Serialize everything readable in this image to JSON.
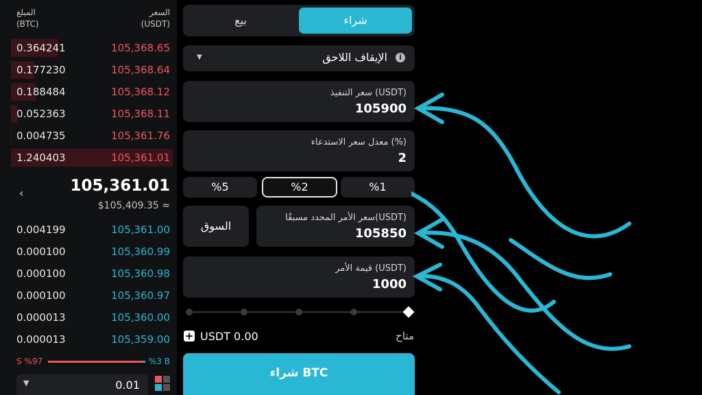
{
  "book": {
    "amount_header": "المبلغ",
    "amount_unit": "(BTC)",
    "price_header": "السعر",
    "price_unit": "(USDT)",
    "asks": [
      {
        "amount": "0.364241",
        "price": "105,368.65"
      },
      {
        "amount": "0.177230",
        "price": "105,368.64"
      },
      {
        "amount": "0.188484",
        "price": "105,368.12"
      },
      {
        "amount": "0.052363",
        "price": "105,368.11"
      },
      {
        "amount": "0.004735",
        "price": "105,361.76"
      },
      {
        "amount": "1.240403",
        "price": "105,361.01"
      }
    ],
    "last_price": "105,361.01",
    "last_price_usd": "$105,409.35 ≈",
    "bids": [
      {
        "amount": "0.004199",
        "price": "105,361.00"
      },
      {
        "amount": "0.000100",
        "price": "105,360.99"
      },
      {
        "amount": "0.000100",
        "price": "105,360.98"
      },
      {
        "amount": "0.000100",
        "price": "105,360.97"
      },
      {
        "amount": "0.000013",
        "price": "105,360.00"
      },
      {
        "amount": "0.000013",
        "price": "105,359.00"
      }
    ],
    "sell_ratio": "S %97",
    "buy_ratio": "%3 B",
    "sell_ratio_value": 0.97,
    "precision": "0.01"
  },
  "form": {
    "buy_tab": "شراء",
    "sell_tab": "بيع",
    "order_type": "الإيقاف اللاحق",
    "exec_price_label": "سعر التنفيذ (USDT)",
    "exec_price_value": "105900",
    "callback_label": "معدل سعر الاستدعاء (%)",
    "callback_value": "2",
    "pct_options": [
      "%5",
      "%2",
      "%1"
    ],
    "selected_pct": "%2",
    "market_button": "السوق",
    "preset_price_label": "سعر الأمر المحدد مسبقًا(USDT)",
    "preset_price_value": "105850",
    "order_value_label": "قيمة الأمر (USDT)",
    "order_value_value": "1000",
    "available_label": "متاح",
    "available_value": "USDT 0.00",
    "submit_button": "شراء BTC"
  },
  "colors": {
    "accent": "#29b7d3",
    "ask": "#f0545f",
    "bid": "#29b7d3",
    "panel": "#1f2023",
    "background": "#000000"
  }
}
